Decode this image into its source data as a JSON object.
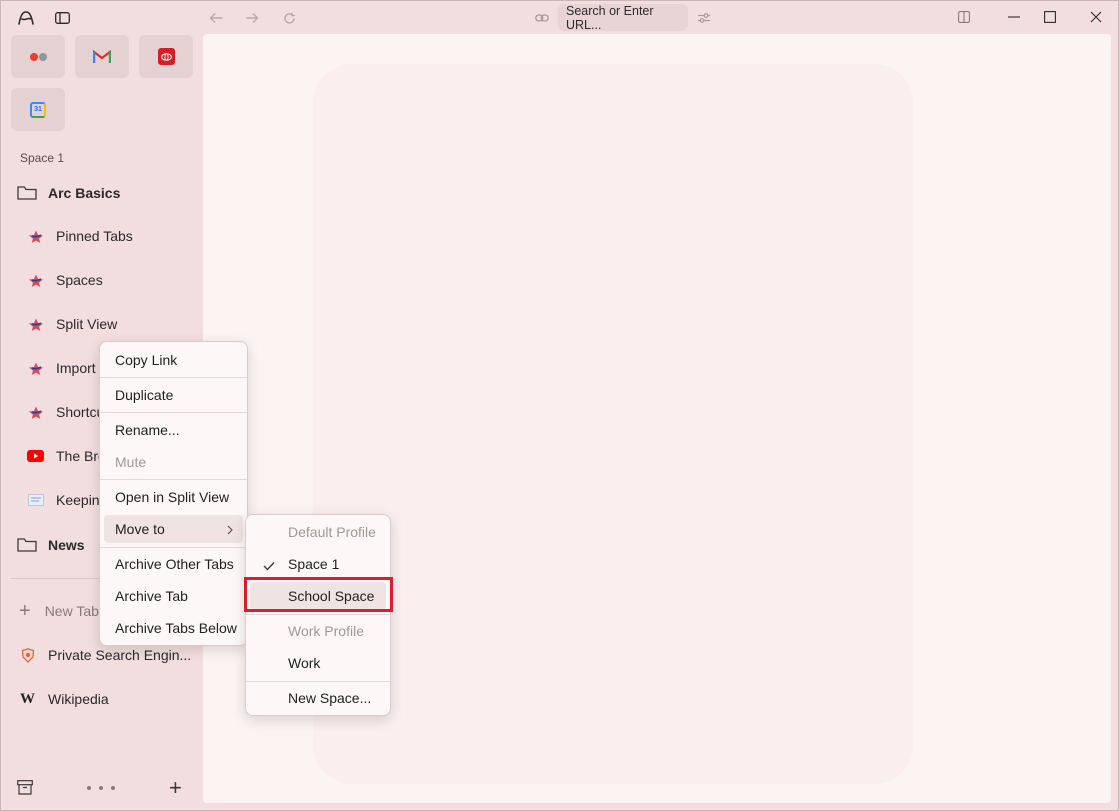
{
  "toolbar": {
    "url_placeholder": "Search or Enter URL..."
  },
  "sidebar": {
    "space_name": "Space 1",
    "folders": [
      {
        "label": "Arc Basics"
      },
      {
        "label": "News"
      }
    ],
    "tabs": [
      {
        "label": "Pinned Tabs"
      },
      {
        "label": "Spaces"
      },
      {
        "label": "Split View"
      },
      {
        "label": "Import"
      },
      {
        "label": "Shortcu"
      },
      {
        "label": "The Bro"
      },
      {
        "label": "Keepin"
      }
    ],
    "new_tab": "New Tab",
    "unpinned": [
      {
        "label": "Private Search Engin..."
      },
      {
        "label": "Wikipedia"
      }
    ],
    "calendar_day": "31"
  },
  "context_menu": {
    "items": [
      {
        "label": "Copy Link"
      },
      {
        "label": "Duplicate"
      },
      {
        "label": "Rename..."
      },
      {
        "label": "Mute"
      },
      {
        "label": "Open in Split View"
      },
      {
        "label": "Move to"
      },
      {
        "label": "Archive Other Tabs"
      },
      {
        "label": "Archive Tab"
      },
      {
        "label": "Archive Tabs Below"
      }
    ]
  },
  "submenu": {
    "items": [
      {
        "label": "Default Profile"
      },
      {
        "label": "Space 1",
        "checked": true
      },
      {
        "label": "School Space"
      },
      {
        "label": "Work Profile"
      },
      {
        "label": "Work"
      },
      {
        "label": "New Space..."
      }
    ]
  },
  "colors": {
    "highlight_box": "#d6202a",
    "sidebar_bg": "#f2dedf",
    "content_bg": "#fcf3f3"
  }
}
